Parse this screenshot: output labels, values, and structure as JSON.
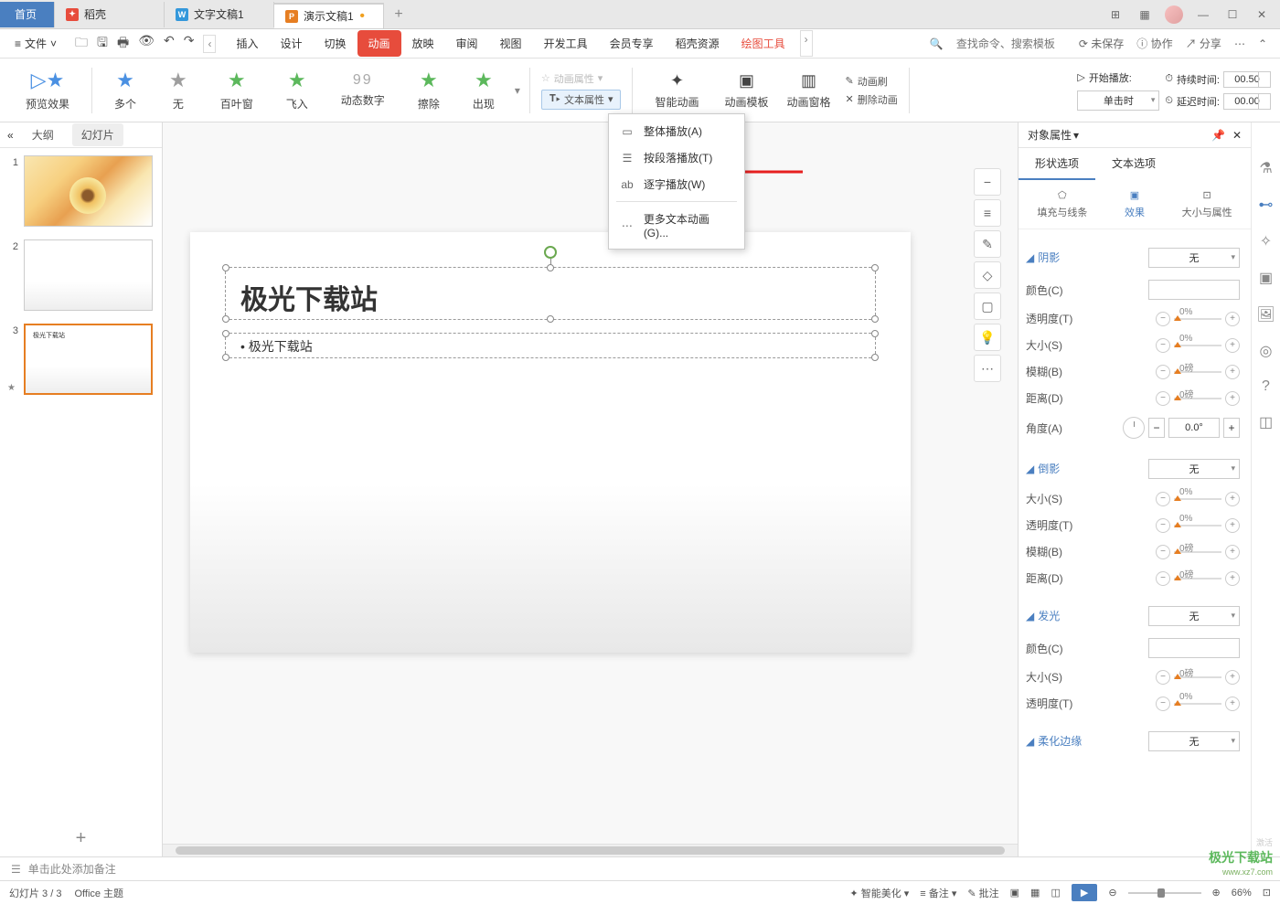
{
  "titlebar": {
    "tabs": [
      {
        "icon": "home",
        "label": "首页"
      },
      {
        "icon": "red",
        "label": "稻壳"
      },
      {
        "icon": "blue",
        "label": "文字文稿1"
      },
      {
        "icon": "orange",
        "label": "演示文稿1",
        "active": true,
        "modified": true
      }
    ]
  },
  "menubar": {
    "file": "文件",
    "tabs": [
      "插入",
      "设计",
      "切换",
      "动画",
      "放映",
      "审阅",
      "视图",
      "开发工具",
      "会员专享",
      "稻壳资源",
      "绘图工具"
    ],
    "active_tab": "动画",
    "contextual_tab": "绘图工具",
    "search_placeholder": "查找命令、搜索模板",
    "unsaved": "未保存",
    "collab": "协作",
    "share": "分享"
  },
  "ribbon": {
    "preview": "预览效果",
    "animations": [
      {
        "label": "多个",
        "color": "blue"
      },
      {
        "label": "无",
        "color": "gray"
      },
      {
        "label": "百叶窗",
        "color": "green"
      },
      {
        "label": "飞入",
        "color": "green"
      },
      {
        "label": "动态数字",
        "color": "num"
      },
      {
        "label": "擦除",
        "color": "green"
      },
      {
        "label": "出现",
        "color": "green"
      }
    ],
    "anim_props": "动画属性",
    "text_props": "文本属性",
    "smart_anim": "智能动画",
    "anim_template": "动画模板",
    "anim_pane": "动画窗格",
    "anim_painter": "动画刷",
    "delete_anim": "删除动画",
    "start_label": "开始播放:",
    "start_value": "单击时",
    "duration_label": "持续时间:",
    "duration_value": "00.50",
    "delay_label": "延迟时间:",
    "delay_value": "00.00"
  },
  "dropdown": {
    "items": [
      {
        "icon": "▭",
        "label": "整体播放(A)"
      },
      {
        "icon": "▭",
        "label": "按段落播放(T)"
      },
      {
        "icon": "⎁",
        "label": "逐字播放(W)"
      }
    ],
    "more": "更多文本动画(G)..."
  },
  "slides": {
    "outline_tab": "大纲",
    "slides_tab": "幻灯片",
    "items": [
      {
        "num": "1",
        "type": "flower"
      },
      {
        "num": "2",
        "type": "blank"
      },
      {
        "num": "3",
        "type": "text",
        "text": "极光下载站",
        "selected": true,
        "animated": true
      }
    ]
  },
  "canvas": {
    "title": "极光下载站",
    "bullet": "• 极光下载站"
  },
  "right_panel": {
    "header": "对象属性",
    "tabs": {
      "shape": "形状选项",
      "text": "文本选项"
    },
    "subtabs": {
      "fill": "填充与线条",
      "effect": "效果",
      "size": "大小与属性"
    },
    "shadow": {
      "title": "阴影",
      "preset": "无",
      "color": "颜色(C)",
      "transparency": "透明度(T)",
      "transparency_val": "0%",
      "size": "大小(S)",
      "size_val": "0%",
      "blur": "模糊(B)",
      "blur_val": "0磅",
      "distance": "距离(D)",
      "distance_val": "0磅",
      "angle": "角度(A)",
      "angle_val": "0.0°"
    },
    "reflection": {
      "title": "倒影",
      "preset": "无",
      "size": "大小(S)",
      "size_val": "0%",
      "transparency": "透明度(T)",
      "transparency_val": "0%",
      "blur": "模糊(B)",
      "blur_val": "0磅",
      "distance": "距离(D)",
      "distance_val": "0磅"
    },
    "glow": {
      "title": "发光",
      "preset": "无",
      "color": "颜色(C)",
      "size": "大小(S)",
      "size_val": "0磅",
      "transparency": "透明度(T)",
      "transparency_val": "0%"
    },
    "soft_edge": {
      "title": "柔化边缘",
      "preset": "无"
    }
  },
  "notes": "单击此处添加备注",
  "status": {
    "slide_info": "幻灯片 3 / 3",
    "theme": "Office 主题",
    "beautify": "智能美化",
    "notes": "备注",
    "comments": "批注",
    "zoom": "66%"
  },
  "watermark": {
    "activate": "激活",
    "site": "极光下载站",
    "url": "www.xz7.com"
  }
}
